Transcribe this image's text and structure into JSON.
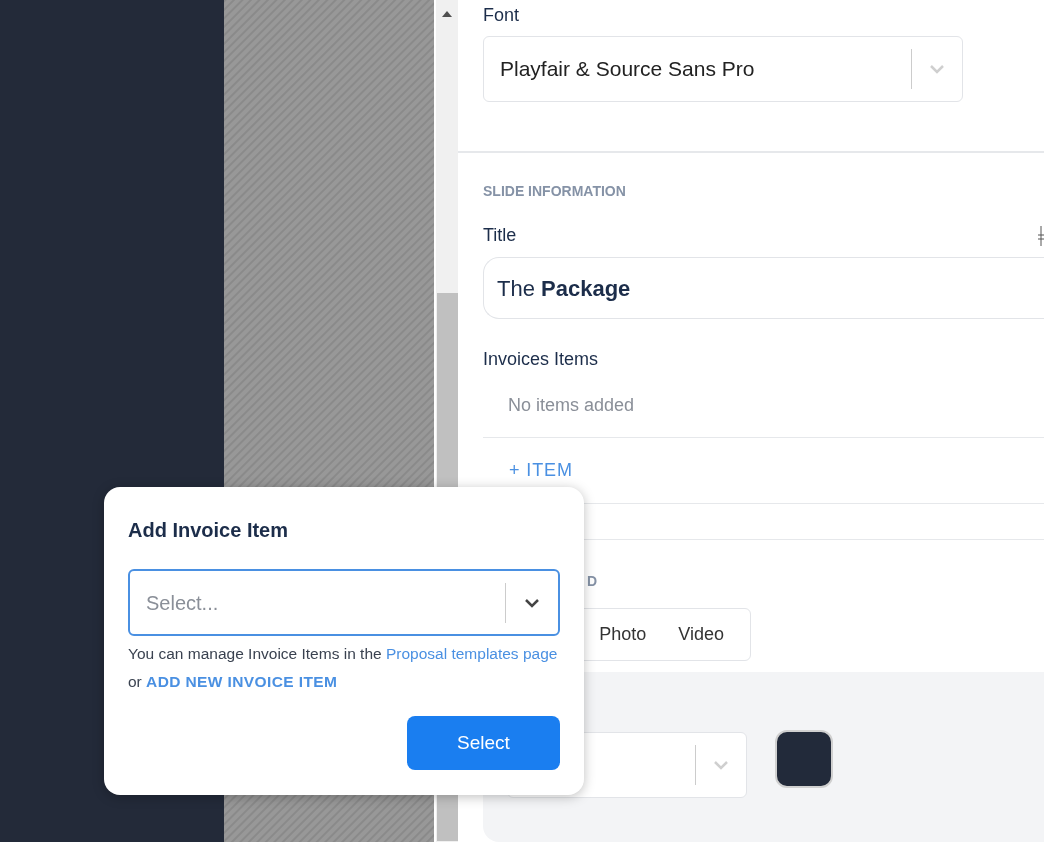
{
  "font": {
    "label": "Font",
    "value": "Playfair & Source Sans Pro"
  },
  "slide_information": {
    "heading": "SLIDE INFORMATION",
    "title_label": "Title",
    "title_value": "The **Package**",
    "invoice_items": {
      "label": "Invoices Items",
      "empty_text": "No items added",
      "add_button": "+ ITEM"
    },
    "background_label": "D",
    "media_tabs": [
      {
        "label": "Photo",
        "selected": false
      },
      {
        "label": "Video",
        "selected": false
      }
    ],
    "swatch": {
      "color": "#222a3a"
    }
  },
  "dialog": {
    "title": "Add Invoice Item",
    "select": {
      "placeholder": "Select...",
      "focused": true
    },
    "help_prefix": "You can manage Invoice Items in the",
    "help_link": "Proposal templates page",
    "help_or": "or",
    "help_action": "ADD NEW INVOICE ITEM",
    "button": "Select"
  }
}
